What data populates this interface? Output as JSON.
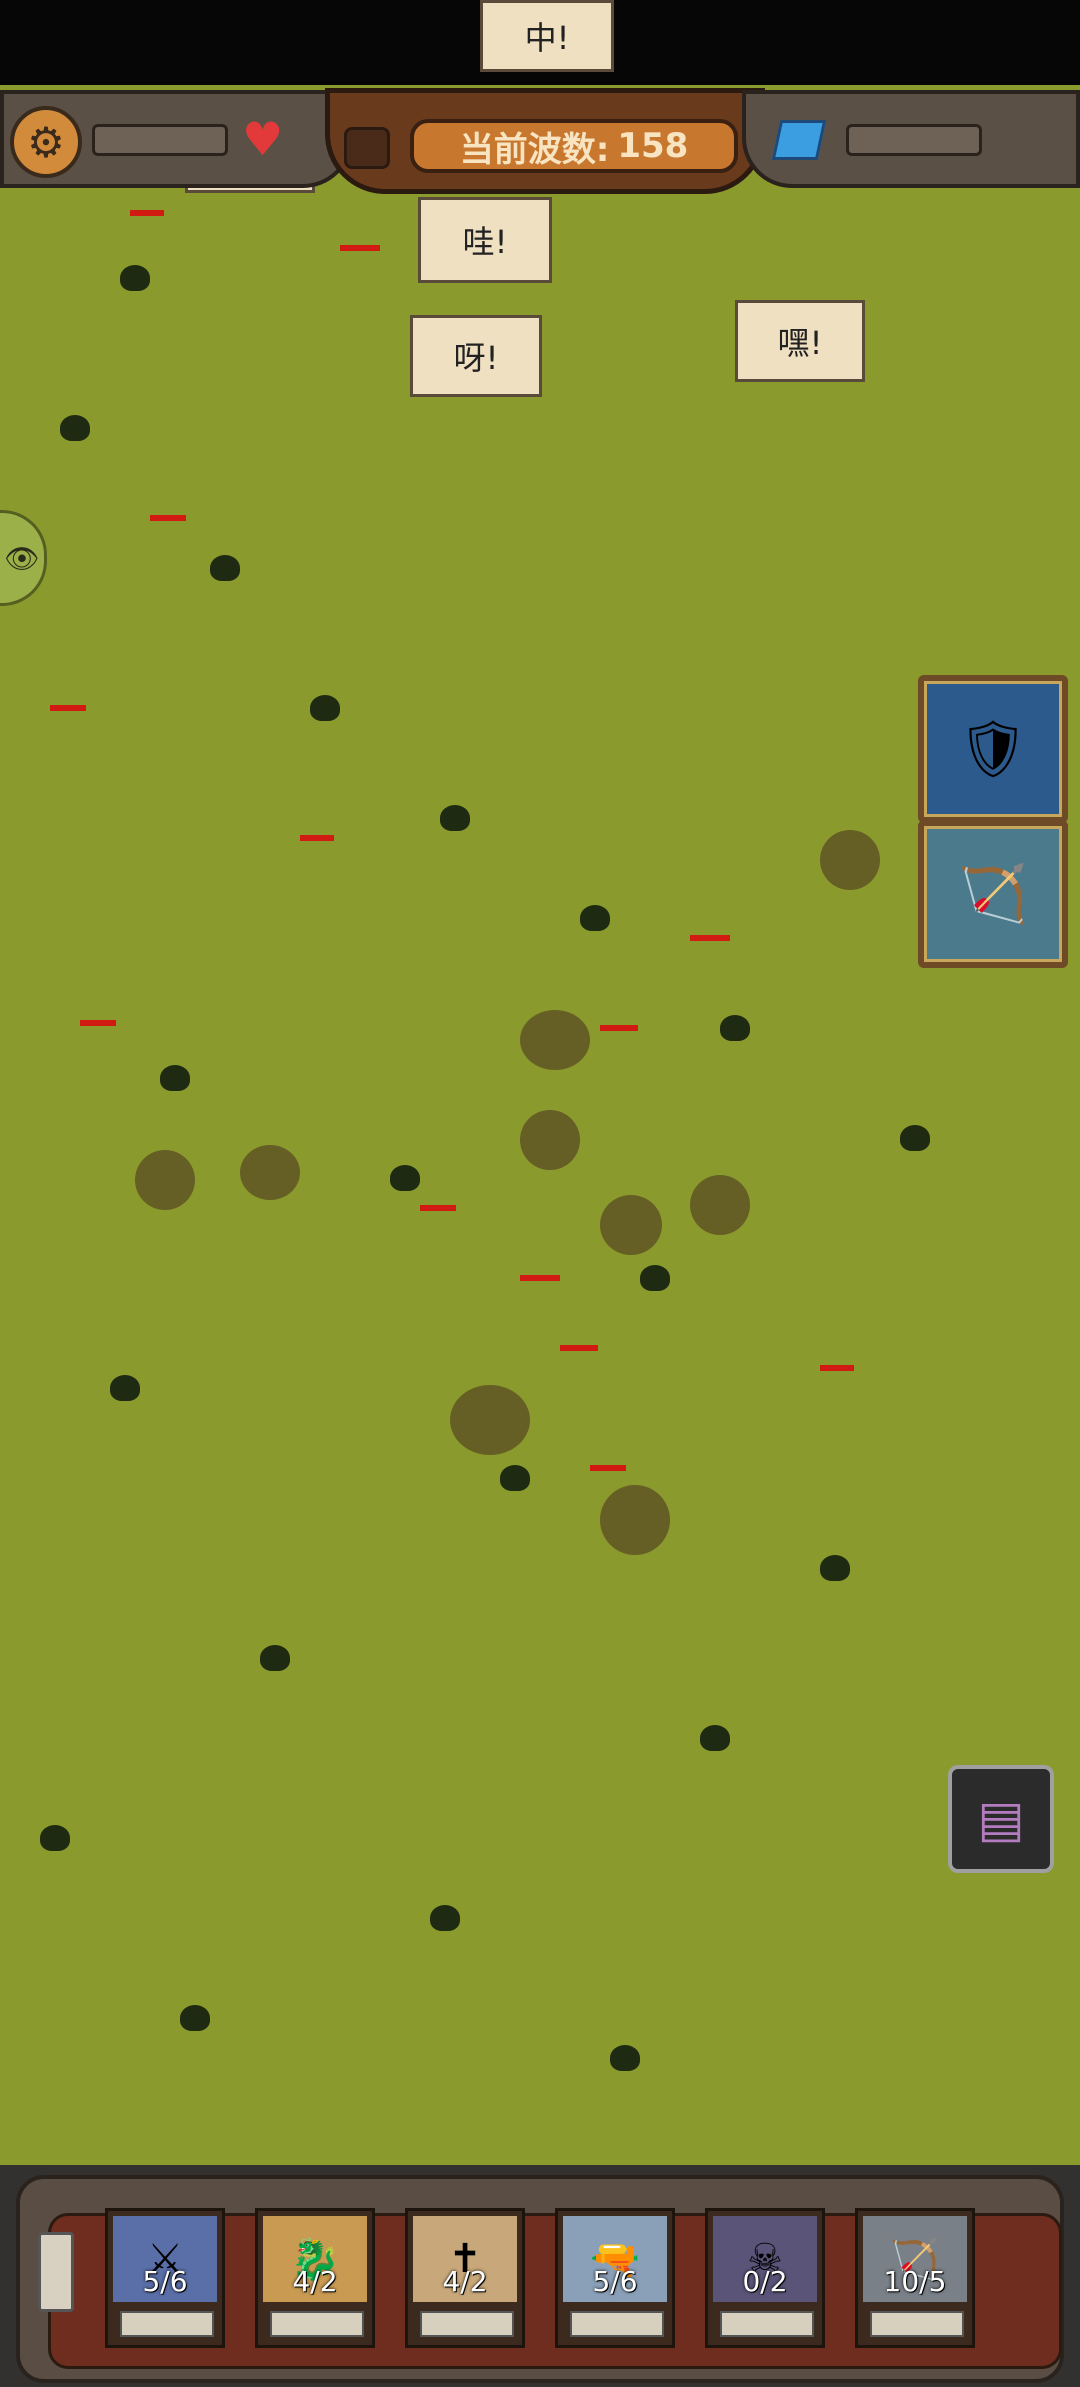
{
  "colors": {
    "grass": "#8a9a2c",
    "panel": "#5a5046",
    "health_bar": "#d01a12",
    "wave_badge": "#c8772f"
  },
  "top_bubble": {
    "text": "中!"
  },
  "hud": {
    "settings_icon": "gear-icon",
    "lives_icon": "heart-icon",
    "currency_icon": "gem-icon",
    "wave_label": "当前波数:",
    "wave_number": "158"
  },
  "speech_bubbles": [
    "嘿!",
    "哇!",
    "呀!",
    "嘿!"
  ],
  "skill_buttons": [
    {
      "name": "shield-sword-skill",
      "icon": "🛡"
    },
    {
      "name": "ballista-skill",
      "icon": "🏹"
    }
  ],
  "side_toggle": {
    "icon": "👁"
  },
  "treasure_chest": {
    "icon": "chest-icon"
  },
  "unit_deck": [
    {
      "name": "spartan",
      "count": "5/6",
      "portrait": "⚔"
    },
    {
      "name": "dragon-knight",
      "count": "4/2",
      "portrait": "🐉"
    },
    {
      "name": "priest",
      "count": "4/2",
      "portrait": "✝"
    },
    {
      "name": "gunslinger",
      "count": "5/6",
      "portrait": "🔫"
    },
    {
      "name": "dark-mage",
      "count": "0/2",
      "portrait": "☠"
    },
    {
      "name": "ballista",
      "count": "10/5",
      "portrait": "🏹"
    }
  ]
}
